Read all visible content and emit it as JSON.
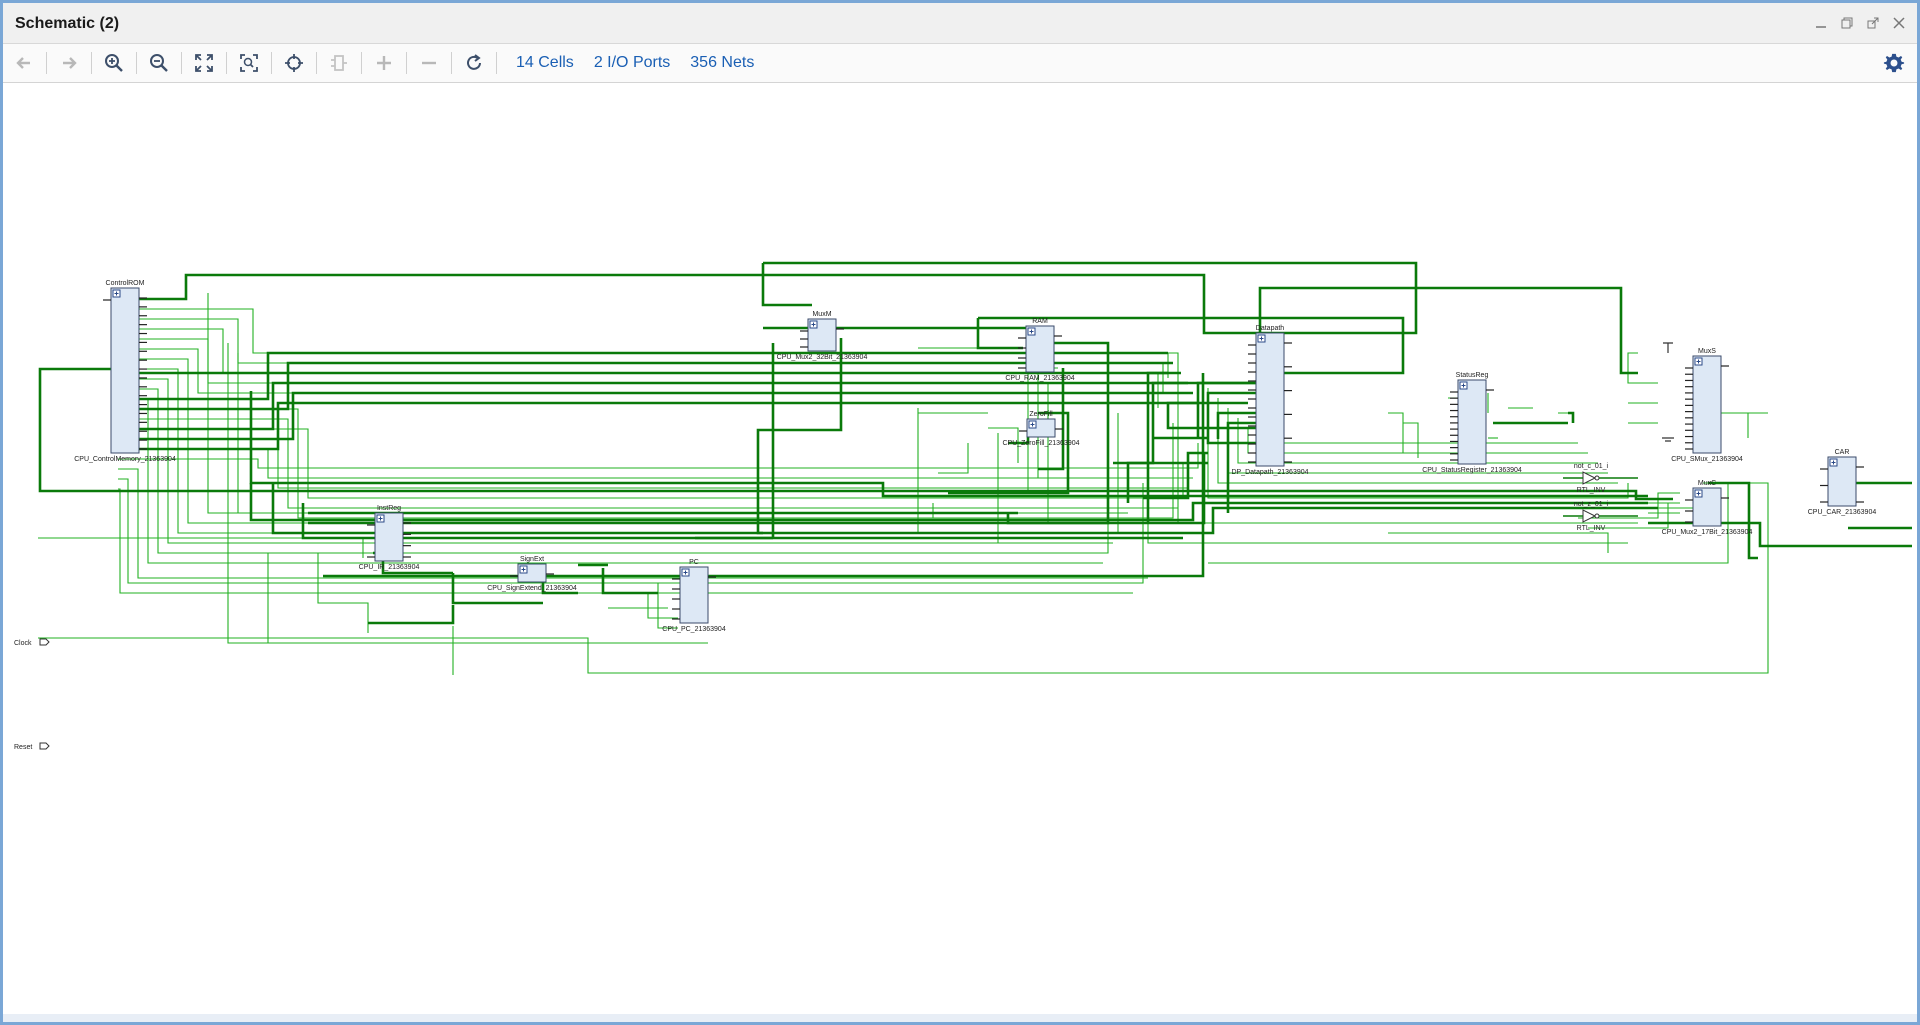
{
  "window": {
    "title": "Schematic (2)"
  },
  "toolbar": {
    "buttons": [
      {
        "name": "back-button",
        "icon": "arrow-left-icon",
        "enabled": false
      },
      {
        "name": "forward-button",
        "icon": "arrow-right-icon",
        "enabled": false
      },
      {
        "name": "zoom-in-button",
        "icon": "zoom-in-icon",
        "enabled": true
      },
      {
        "name": "zoom-out-button",
        "icon": "zoom-out-icon",
        "enabled": true
      },
      {
        "name": "zoom-fit-button",
        "icon": "fit-icon",
        "enabled": true
      },
      {
        "name": "zoom-area-button",
        "icon": "zoom-area-icon",
        "enabled": true
      },
      {
        "name": "select-button",
        "icon": "crosshair-icon",
        "enabled": true
      },
      {
        "name": "expand-button",
        "icon": "cell-icon",
        "enabled": false
      },
      {
        "name": "add-button",
        "icon": "plus-icon",
        "enabled": false
      },
      {
        "name": "remove-button",
        "icon": "minus-icon",
        "enabled": false
      },
      {
        "name": "refresh-button",
        "icon": "refresh-icon",
        "enabled": true
      }
    ],
    "cells": "14 Cells",
    "io_ports": "2 I/O Ports",
    "nets": "356 Nets",
    "settings_icon": "gear-icon"
  },
  "colors": {
    "wire": "#00a000",
    "wire_bus": "#006a00",
    "cell_fill": "#dde8f5",
    "cell_border": "#3a4a6a",
    "accent": "#1a5fb4"
  },
  "schematic": {
    "ports": [
      {
        "label": "Clock"
      },
      {
        "label": "Reset"
      }
    ],
    "cells": [
      {
        "id": "controlrom",
        "top": "ControlROM",
        "bottom": "CPU_ControlMemory_21363904"
      },
      {
        "id": "muxm",
        "top": "MuxM",
        "bottom": "CPU_Mux2_32Bit_21363904"
      },
      {
        "id": "ram",
        "top": "RAM",
        "bottom": "CPU_RAM_21363904"
      },
      {
        "id": "zerofill",
        "top": "ZeroFill",
        "bottom": "CPU_ZeroFill_21363904"
      },
      {
        "id": "datapath",
        "top": "Datapath",
        "bottom": "DP_Datapath_21363904"
      },
      {
        "id": "statusreg",
        "top": "StatusReg",
        "bottom": "CPU_StatusRegister_21363904"
      },
      {
        "id": "muxs",
        "top": "MuxS",
        "bottom": "CPU_SMux_21363904"
      },
      {
        "id": "car",
        "top": "CAR",
        "bottom": "CPU_CAR_21363904"
      },
      {
        "id": "muxc",
        "top": "MuxC",
        "bottom": "CPU_Mux2_17Bit_21363904"
      },
      {
        "id": "instreg",
        "top": "InstReg",
        "bottom": "CPU_IR_21363904"
      },
      {
        "id": "signext",
        "top": "SignExt",
        "bottom": "CPU_SignExtend_21363904"
      },
      {
        "id": "pc",
        "top": "PC",
        "bottom": "CPU_PC_21363904"
      }
    ],
    "inverters": [
      {
        "id": "inv1",
        "top": "not_c_01_i",
        "bottom": "RTL_INV"
      },
      {
        "id": "inv2",
        "top": "not_z_01_i",
        "bottom": "RTL_INV"
      }
    ]
  }
}
